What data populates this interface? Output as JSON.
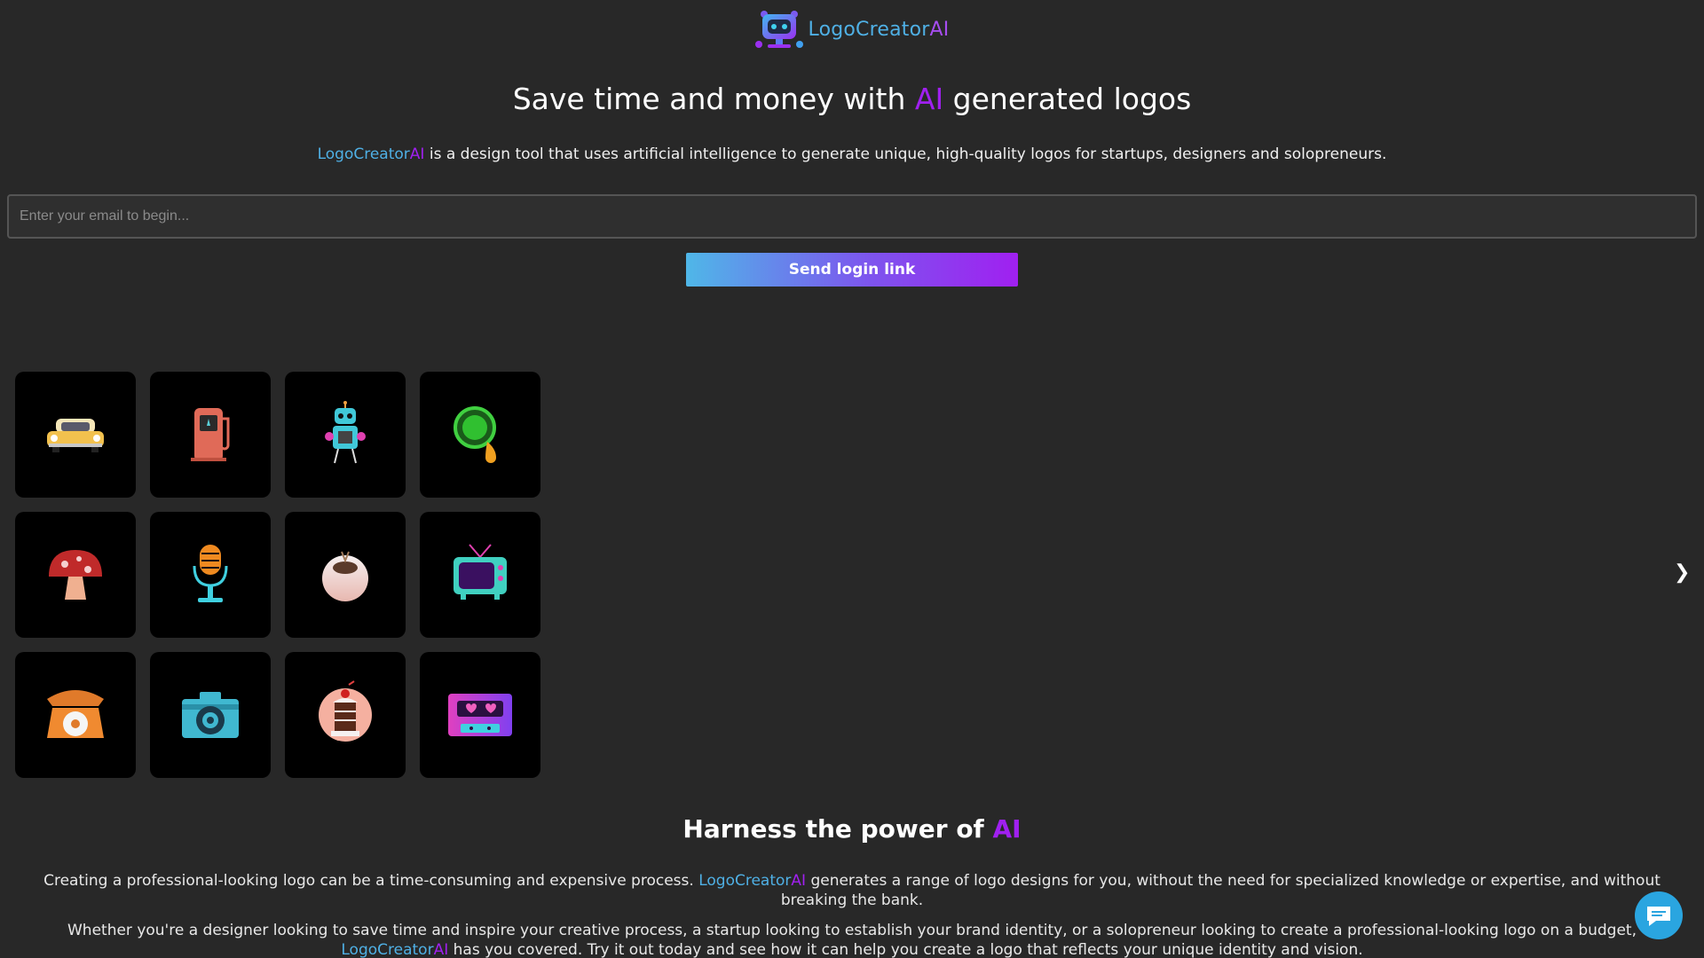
{
  "brand": {
    "name_part1": "LogoCreator",
    "name_part2": "AI"
  },
  "hero": {
    "title_before": "Save time and money with ",
    "title_highlight": "AI",
    "title_after": " generated logos",
    "sub_brand_part1": "LogoCreator",
    "sub_brand_part2": "AI",
    "sub_text": " is a design tool that uses artificial intelligence to generate unique, high-quality logos for startups, designers and solopreneurs."
  },
  "login": {
    "email_placeholder": "Enter your email to begin...",
    "email_value": "",
    "send_label": "Send login link"
  },
  "carousel": {
    "prev_label": "❮",
    "next_label": "❯",
    "icons": [
      "car-icon",
      "fuel-pump-icon",
      "robot-icon",
      "magnifier-icon",
      "mushroom-icon",
      "microphone-icon",
      "coconut-icon",
      "tv-icon",
      "telephone-icon",
      "camera-icon",
      "milkshake-icon",
      "cassette-icon"
    ]
  },
  "harness": {
    "title_before": "Harness the power of ",
    "title_highlight": "AI",
    "p1_before": "Creating a professional-looking logo can be a time-consuming and expensive process. ",
    "p1_brand1": "LogoCreator",
    "p1_brand2": "AI",
    "p1_after": " generates a range of logo designs for you, without the need for specialized knowledge or expertise, and without breaking the bank.",
    "p2_before": "Whether you're a designer looking to save time and inspire your creative process, a startup looking to establish your brand identity, or a solopreneur looking to create a professional-looking logo on a budget, ",
    "p2_brand1": "LogoCreator",
    "p2_brand2": "AI",
    "p2_after": " has you covered. Try it out today and see how it can help you create a logo that reflects your unique identity and vision."
  },
  "colors": {
    "background": "#282828",
    "brand_blue": "#4fb0e5",
    "brand_purple": "#a020f0",
    "chat_blue": "#2aa5e0"
  }
}
